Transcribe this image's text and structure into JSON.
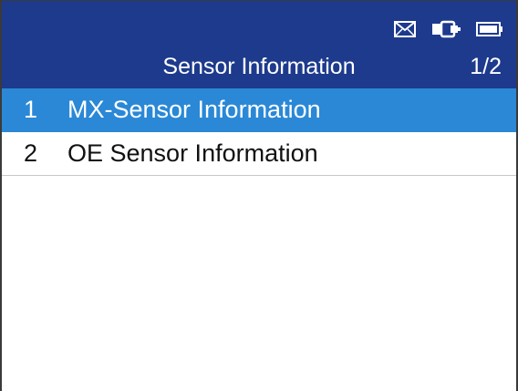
{
  "header": {
    "title": "Sensor Information",
    "page_indicator": "1/2",
    "status_icons": [
      "mail-icon",
      "vehicle-connection-icon",
      "battery-icon"
    ]
  },
  "menu": {
    "items": [
      {
        "number": "1",
        "label": "MX-Sensor Information",
        "selected": true
      },
      {
        "number": "2",
        "label": "OE Sensor Information",
        "selected": false
      }
    ]
  },
  "colors": {
    "header_bg": "#1d3a8c",
    "selected_bg": "#2a88d6",
    "text": "#111111",
    "header_text": "#ffffff"
  }
}
